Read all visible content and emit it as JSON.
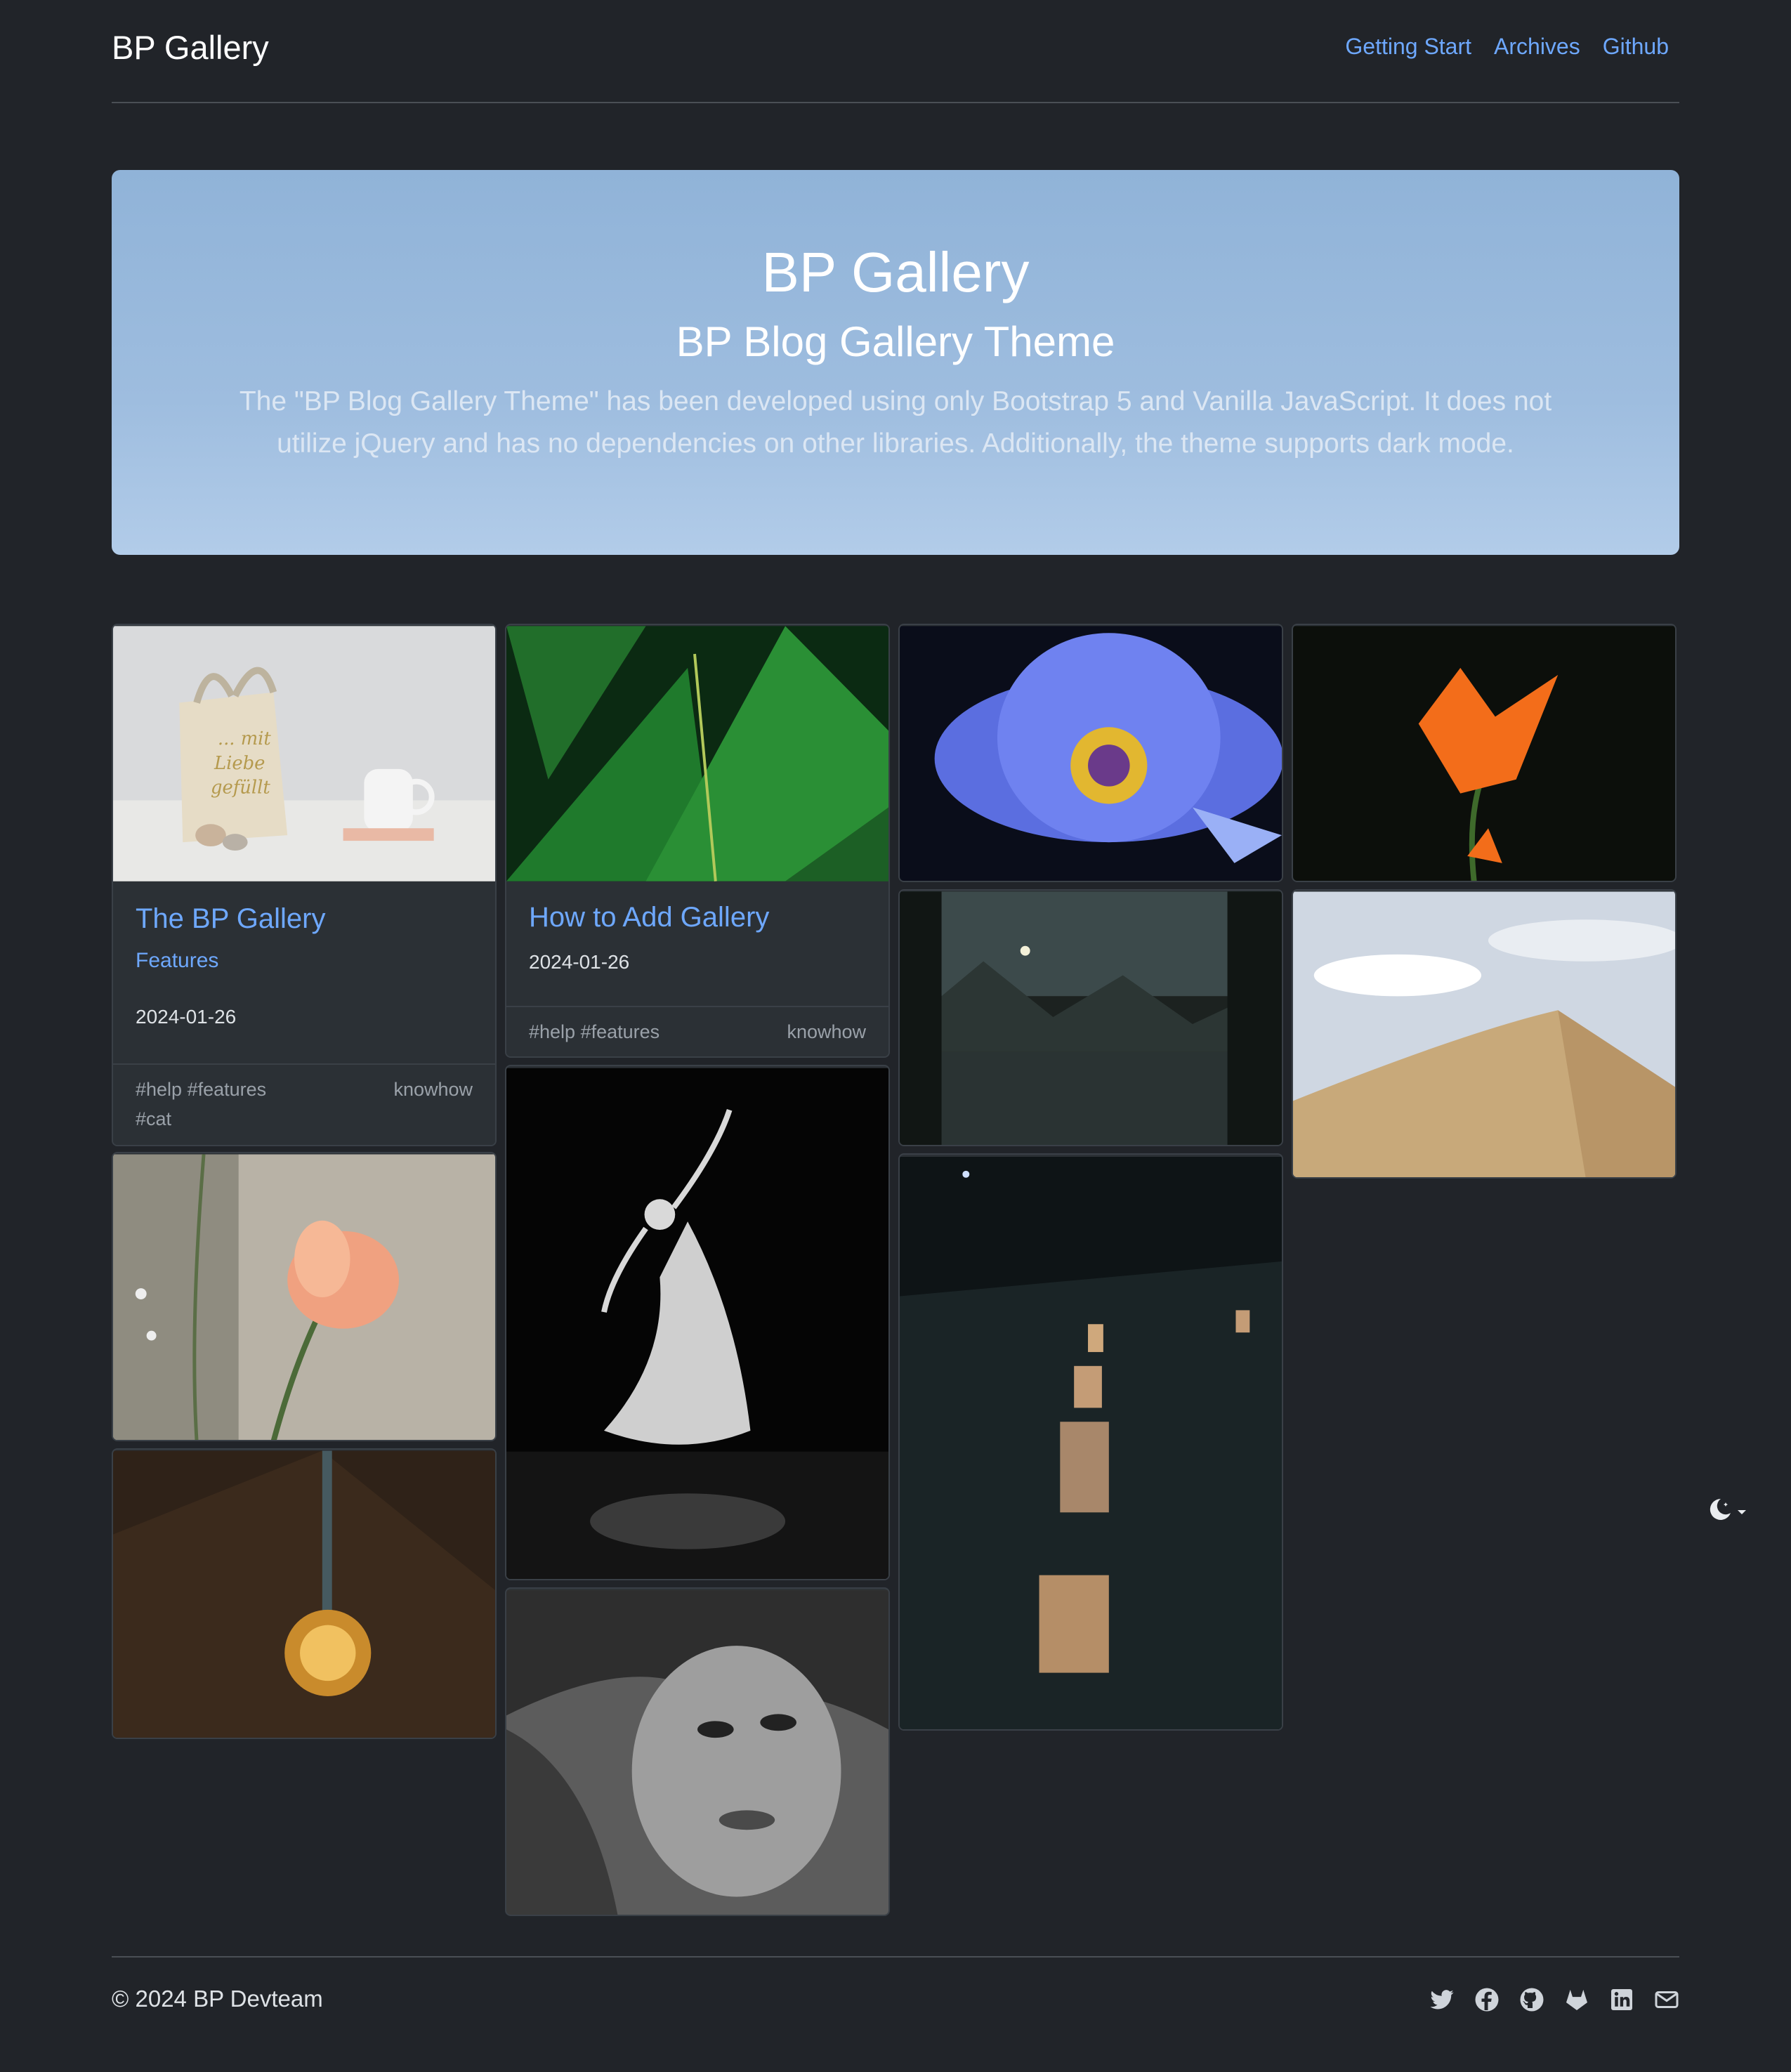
{
  "header": {
    "brand": "BP Gallery",
    "nav": [
      "Getting Start",
      "Archives",
      "Github"
    ]
  },
  "hero": {
    "title": "BP Gallery",
    "subtitle": "BP Blog Gallery Theme",
    "lead": "The \"BP Blog Gallery Theme\" has been developed using only Bootstrap 5 and Vanilla JavaScript. It does not utilize jQuery and has no dependencies on other libraries. Additionally, the theme supports dark mode."
  },
  "posts": [
    {
      "title": "The BP Gallery",
      "category": "Features",
      "date": "2024-01-26",
      "tags": "#help #features",
      "tags2": "#cat",
      "label": "knowhow"
    },
    {
      "title": "How to Add Gallery",
      "date": "2024-01-26",
      "tags": "#help #features",
      "label": "knowhow"
    }
  ],
  "footer": {
    "copyright": "© 2024 BP Devteam",
    "social_icons": [
      "twitter-icon",
      "facebook-icon",
      "github-icon",
      "gitlab-icon",
      "linkedin-icon",
      "mail-icon"
    ]
  },
  "theme_toggle_icon": "moon-stars-icon",
  "colors": {
    "background": "#212429",
    "link": "#6ea8fe",
    "hero": "#9ebddf"
  }
}
